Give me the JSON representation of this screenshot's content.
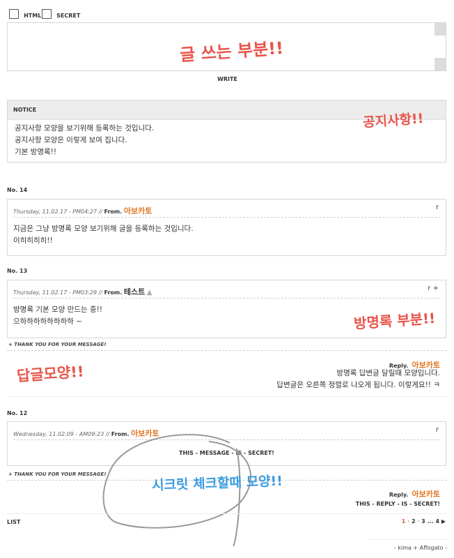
{
  "top": {
    "options": [
      {
        "label": "HTML"
      },
      {
        "label": "SECRET"
      }
    ],
    "editor_annotation": "글 쓰는 부분!!",
    "write_label": "WRITE"
  },
  "notice": {
    "title": "NOTICE",
    "lines": [
      "공지사항 모양을 보기위해 등록하는 것입니다.",
      "공지사항 모양은 이렇게 보여 집니다.",
      "기본 방명록!!"
    ],
    "annotation": "공지사항!!"
  },
  "entries": [
    {
      "no": "No. 14",
      "meta": "Thursday, 11.02.17 - PM04:27 //",
      "from": "From.",
      "author": "아보카토",
      "controls": "r",
      "lines": [
        "지금은 그냥 방명록 모양 보기위해 글을 등록하는 것입니다.",
        "이히히히히!!"
      ]
    },
    {
      "no": "No. 13",
      "meta": "Thursday, 11.02.17 - PM03:29 //",
      "from": "From.",
      "author": "테스트",
      "controls": "r +",
      "lines": [
        "방명록 기본 모양 만드는 중!!",
        "으하하하하하하하하 ~"
      ],
      "annotation": "방명록 부분!!",
      "thank": "+ THANK YOU FOR YOUR MESSAGE!",
      "reply": {
        "label": "Reply.",
        "author": "아보카토",
        "lines": [
          "방명록 답변글 달릴때 모양입니다.",
          "답변글은 오른쪽 정렬로 나오게 됩니다. 이렇게요!! ㅋ"
        ],
        "annotation": "답글모양!!"
      }
    },
    {
      "no": "No. 12",
      "meta": "Wednesday, 11.02.09 - AM09:23 //",
      "from": "From.",
      "author": "아보카토",
      "controls": "r",
      "secret": "THIS - MESSAGE - IS - SECRET!",
      "thank": "+ THANK YOU FOR YOUR MESSAGE!",
      "reply": {
        "label": "Reply.",
        "author": "아보카토",
        "secret": "THIS - REPLY - IS - SECRET!",
        "annotation": "시크릿 체크할때 모양!!"
      }
    }
  ],
  "footer": {
    "list_label": "LIST",
    "pages": [
      "1",
      "2",
      "3",
      "...",
      "4"
    ],
    "next": "▶",
    "credit": "- kima + Affogato -"
  },
  "colors": {
    "author": "#e27320",
    "annotation_red": "#e8554b",
    "annotation_blue": "#3a9be0"
  }
}
